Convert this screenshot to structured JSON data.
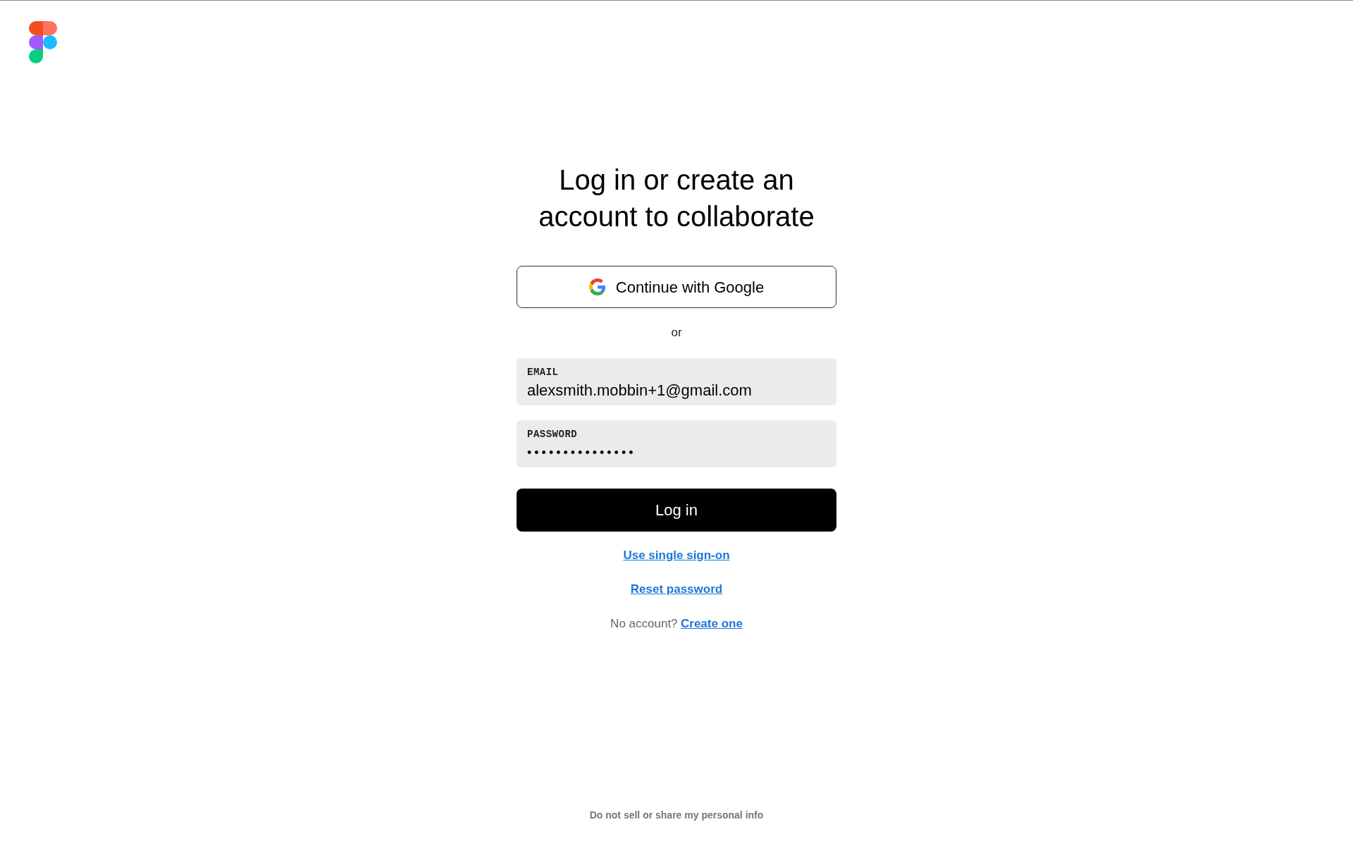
{
  "title": "Log in or create an account to collaborate",
  "google_button": {
    "label": "Continue with Google"
  },
  "separator": "or",
  "fields": [
    {
      "label": "EMAIL",
      "value": "alexsmith.mobbin+1@gmail.com"
    },
    {
      "label": "PASSWORD",
      "value": "•••••••••••••••"
    }
  ],
  "login_button": "Log in",
  "links": [
    "Use single sign-on",
    "Reset password"
  ],
  "signup": {
    "prompt": "No account?",
    "link": "Create one"
  },
  "footer_link": "Do not sell or share my personal info"
}
